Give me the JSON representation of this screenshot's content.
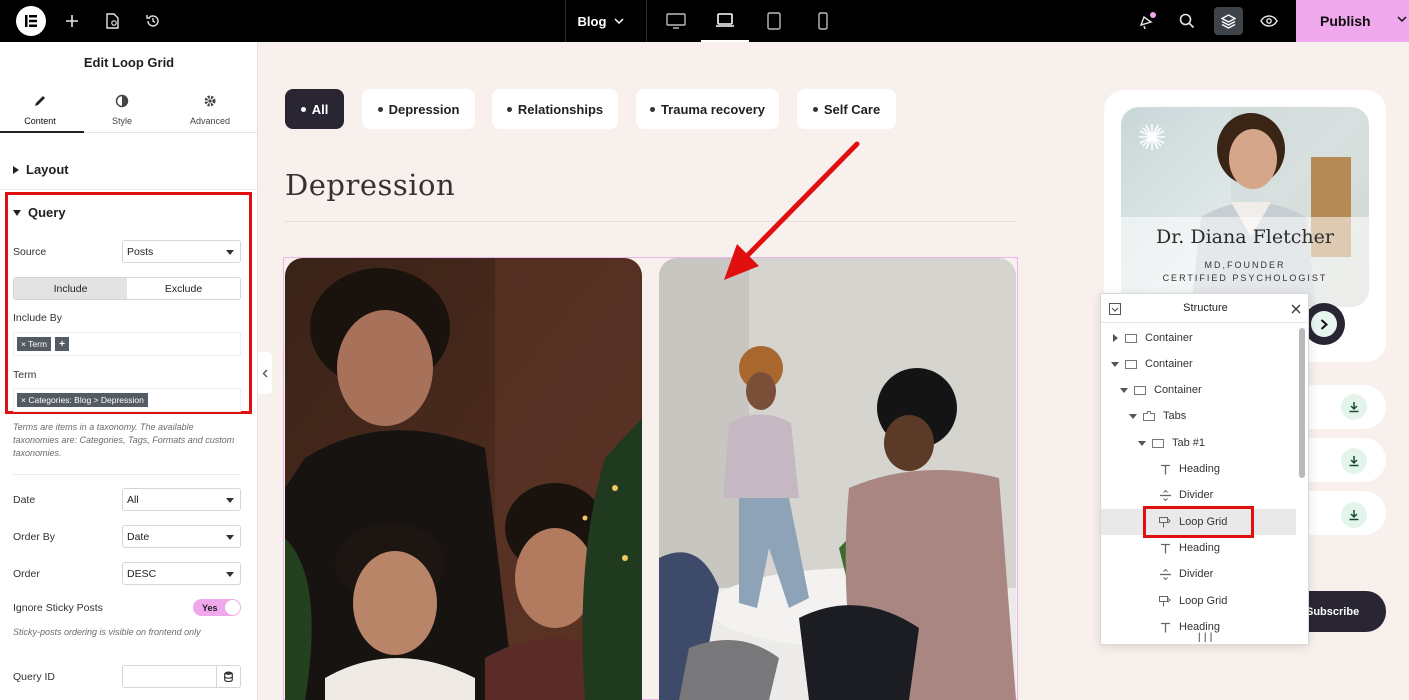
{
  "topbar": {
    "page_selector": "Blog",
    "publish_label": "Publish",
    "icons": [
      "elementor-logo-icon",
      "add-icon",
      "page-settings-icon",
      "history-icon",
      "desktop-icon",
      "laptop-icon",
      "tablet-icon",
      "mobile-icon",
      "notifications-icon",
      "search-icon",
      "structure-layers-icon",
      "preview-eye-icon"
    ],
    "accent_color": "#f0a8ec"
  },
  "panel": {
    "title": "Edit Loop Grid",
    "tabs": [
      {
        "label": "Content",
        "icon": "pencil-icon"
      },
      {
        "label": "Style",
        "icon": "contrast-icon"
      },
      {
        "label": "Advanced",
        "icon": "gear-icon"
      }
    ],
    "sections": {
      "layout": "Layout",
      "query": "Query"
    },
    "source": {
      "label": "Source",
      "value": "Posts"
    },
    "include_exclude": {
      "include": "Include",
      "exclude": "Exclude",
      "selected": "Include"
    },
    "include_by": {
      "label": "Include By",
      "tag": "× Term",
      "add": "+"
    },
    "term": {
      "label": "Term",
      "tag": "× Categories: Blog > Depression"
    },
    "term_help": "Terms are items in a taxonomy. The available taxonomies are: Categories, Tags, Formats and custom taxonomies.",
    "date": {
      "label": "Date",
      "value": "All"
    },
    "order_by": {
      "label": "Order By",
      "value": "Date"
    },
    "order": {
      "label": "Order",
      "value": "DESC"
    },
    "ignore_sticky": {
      "label": "Ignore Sticky Posts",
      "value": "Yes"
    },
    "sticky_help": "Sticky-posts ordering is visible on frontend only",
    "query_id": {
      "label": "Query ID",
      "value": ""
    }
  },
  "canvas": {
    "filters": [
      {
        "label": "All",
        "active": true
      },
      {
        "label": "Depression",
        "active": false
      },
      {
        "label": "Relationships",
        "active": false
      },
      {
        "label": "Trauma recovery",
        "active": false
      },
      {
        "label": "Self Care",
        "active": false
      }
    ],
    "heading": "Depression"
  },
  "profile": {
    "name": "Dr. Diana Fletcher",
    "role": "MD,FOUNDER",
    "title": "CERTIFIED PSYCHOLOGIST"
  },
  "subscribe_label": "Subscribe",
  "structure": {
    "title": "Structure",
    "items": [
      {
        "label": "Container",
        "icon": "container-icon"
      },
      {
        "label": "Container",
        "icon": "container-icon"
      },
      {
        "label": "Container",
        "icon": "container-icon"
      },
      {
        "label": "Tabs",
        "icon": "tabs-icon"
      },
      {
        "label": "Tab #1",
        "icon": "tab-icon"
      },
      {
        "label": "Heading",
        "icon": "heading-icon"
      },
      {
        "label": "Divider",
        "icon": "divider-icon"
      },
      {
        "label": "Loop Grid",
        "icon": "loop-grid-icon",
        "selected": true
      },
      {
        "label": "Heading",
        "icon": "heading-icon"
      },
      {
        "label": "Divider",
        "icon": "divider-icon"
      },
      {
        "label": "Loop Grid",
        "icon": "loop-grid-icon"
      },
      {
        "label": "Heading",
        "icon": "heading-icon"
      }
    ]
  }
}
